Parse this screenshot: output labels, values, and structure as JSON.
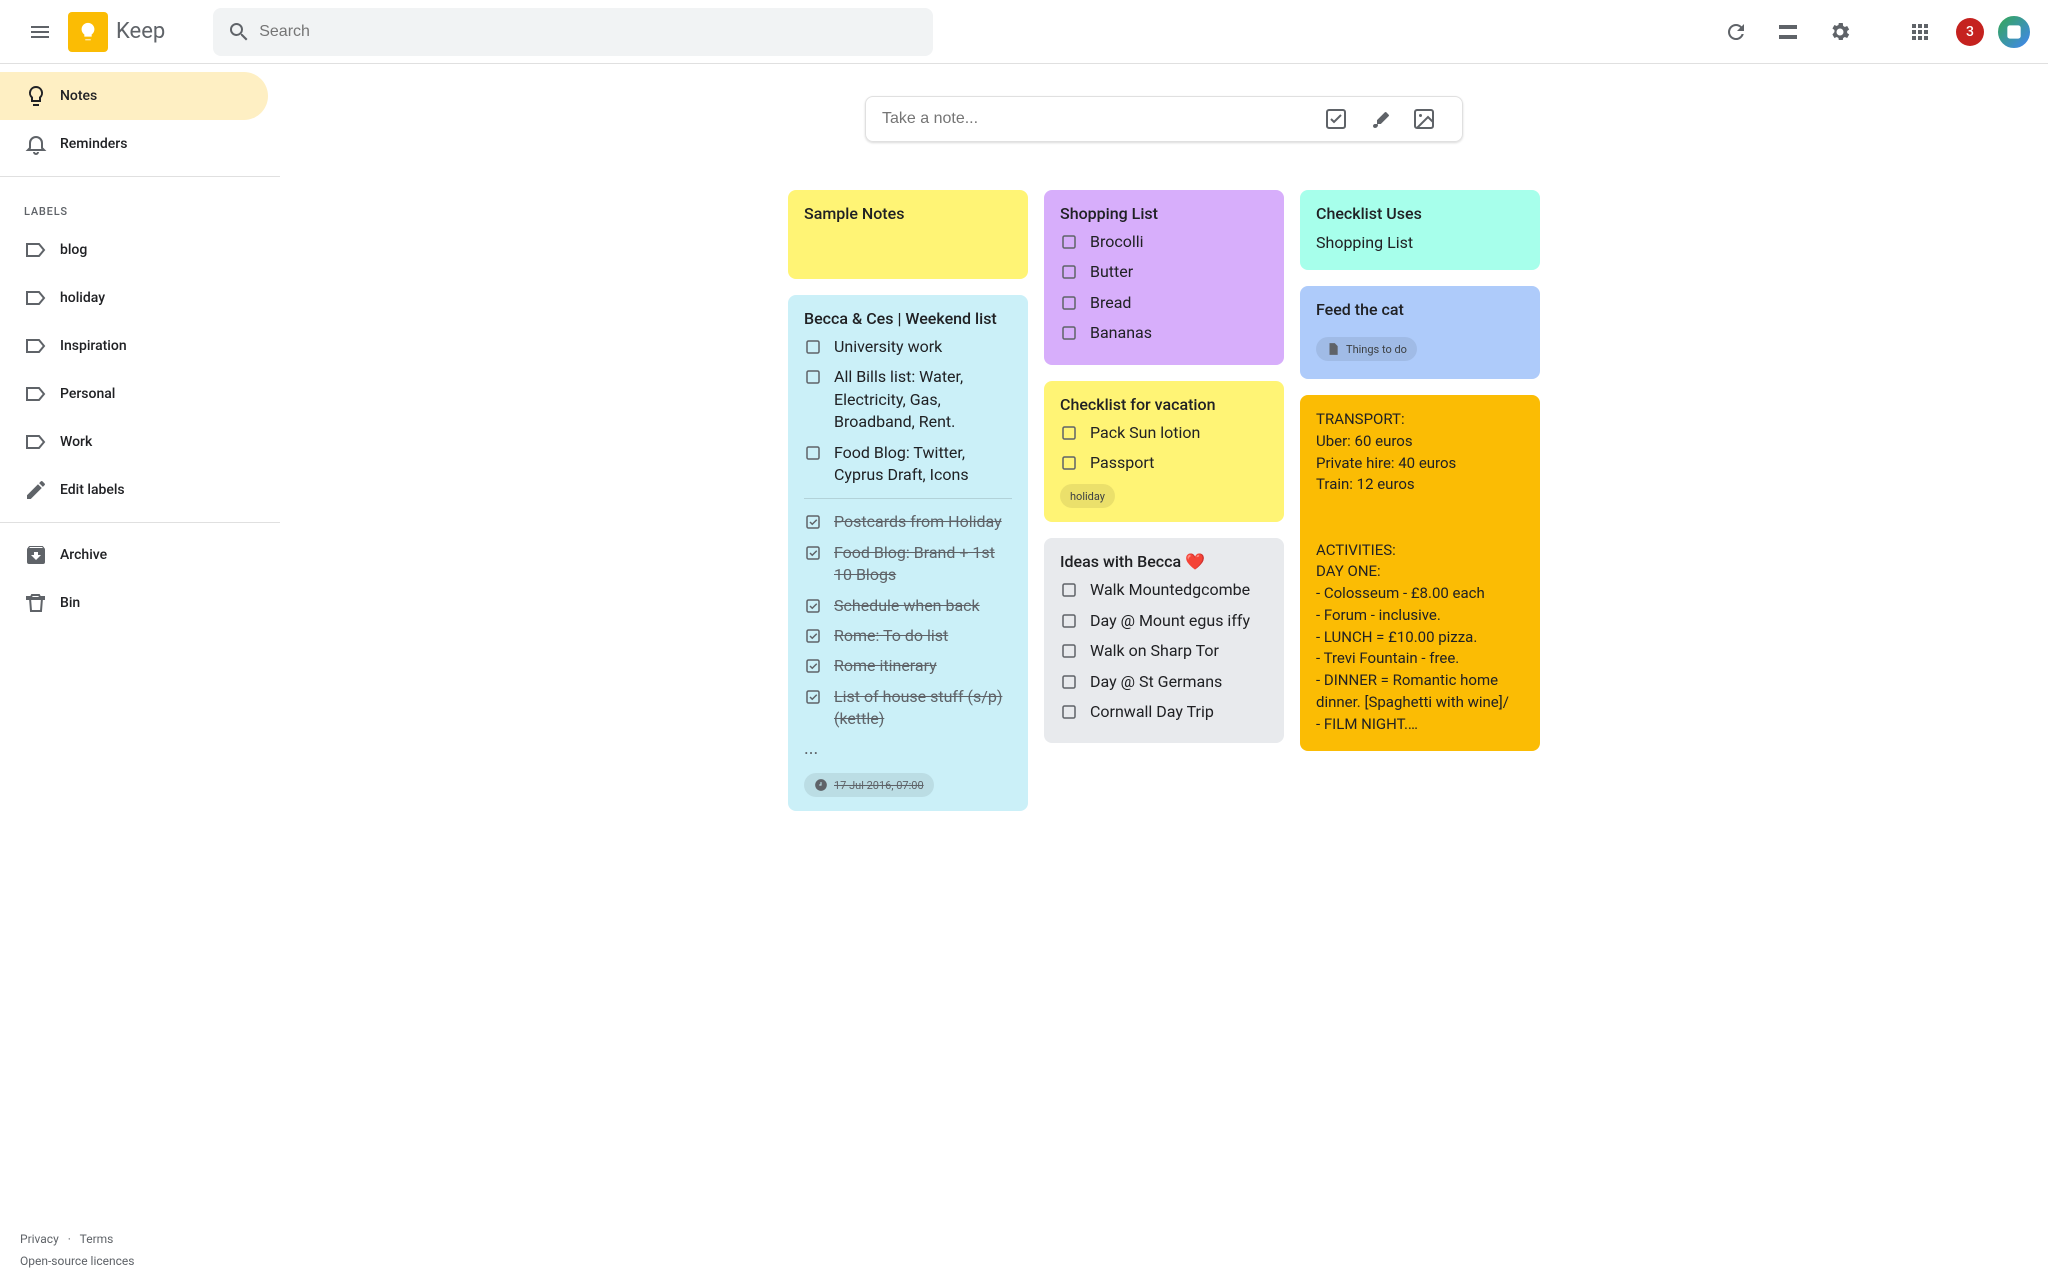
{
  "brand": {
    "name": "Keep"
  },
  "search": {
    "placeholder": "Search"
  },
  "header_badge": "3",
  "compose": {
    "placeholder": "Take a note..."
  },
  "sidebar": {
    "labels_header": "LABELS",
    "items": [
      {
        "label": "Notes",
        "icon": "lightbulb",
        "active": true
      },
      {
        "label": "Reminders",
        "icon": "bell",
        "active": false
      }
    ],
    "labels": [
      {
        "label": "blog"
      },
      {
        "label": "holiday"
      },
      {
        "label": "Inspiration"
      },
      {
        "label": "Personal"
      },
      {
        "label": "Work"
      }
    ],
    "edit_labels": "Edit labels",
    "archive": "Archive",
    "bin": "Bin",
    "footer": {
      "privacy": "Privacy",
      "terms": "Terms",
      "oss": "Open-source licences"
    }
  },
  "columns": [
    [
      {
        "kind": "title-only",
        "title": "Sample Notes",
        "bg": "bg-yellow"
      },
      {
        "kind": "checklist",
        "title": "Becca & Ces | Weekend list",
        "bg": "bg-blue",
        "items": [
          {
            "text": "University work",
            "done": false
          },
          {
            "text": "All Bills list: Water, Electricity, Gas, Broadband, Rent.",
            "done": false
          },
          {
            "text": "Food Blog: Twitter, Cyprus Draft, Icons",
            "done": false
          }
        ],
        "divider_after": 3,
        "done_items": [
          {
            "text": "Postcards from Holiday",
            "done": true
          },
          {
            "text": "Food Blog: Brand + 1st 10 Blogs",
            "done": true
          },
          {
            "text": "Schedule when back",
            "done": true
          },
          {
            "text": "Rome: To do list",
            "done": true
          },
          {
            "text": "Rome itinerary",
            "done": true
          },
          {
            "text": "List of house stuff (s/p) (kettle)",
            "done": true
          }
        ],
        "overflow": "...",
        "reminder": "17 Jul 2016, 07:00",
        "reminder_done": true
      }
    ],
    [
      {
        "kind": "checklist",
        "title": "Shopping List",
        "bg": "bg-purple",
        "items": [
          {
            "text": "Brocolli",
            "done": false
          },
          {
            "text": "Butter",
            "done": false
          },
          {
            "text": "Bread",
            "done": false
          },
          {
            "text": "Bananas",
            "done": false
          }
        ]
      },
      {
        "kind": "checklist",
        "title": "Checklist for vacation",
        "bg": "bg-yellow",
        "items": [
          {
            "text": "Pack Sun lotion",
            "done": false
          },
          {
            "text": "Passport",
            "done": false
          }
        ],
        "tags": [
          "holiday"
        ]
      },
      {
        "kind": "checklist",
        "title": "Ideas with Becca ❤️",
        "bg": "bg-gray",
        "items": [
          {
            "text": "Walk Mountedgcombe",
            "done": false
          },
          {
            "text": "Day @ Mount egus iffy",
            "done": false
          },
          {
            "text": "Walk on Sharp Tor",
            "done": false
          },
          {
            "text": "Day @ St Germans",
            "done": false
          },
          {
            "text": "Cornwall Day Trip",
            "done": false
          }
        ]
      }
    ],
    [
      {
        "kind": "text",
        "title": "Checklist Uses",
        "body": "Shopping List",
        "bg": "bg-teal"
      },
      {
        "kind": "text",
        "title": "Feed the cat",
        "bg": "bg-blue2",
        "doc_chip": "Things to do"
      },
      {
        "kind": "text",
        "bg": "bg-orange",
        "body": "TRANSPORT:\nUber: 60 euros\nPrivate hire: 40 euros\nTrain: 12 euros\n\n\nACTIVITIES:\nDAY ONE:\n- Colosseum - £8.00 each\n- Forum - inclusive.\n- LUNCH = £10.00 pizza.\n- Trevi Fountain - free.\n- DINNER = Romantic home dinner. [Spaghetti with wine]/\n- FILM NIGHT.…"
      }
    ]
  ]
}
